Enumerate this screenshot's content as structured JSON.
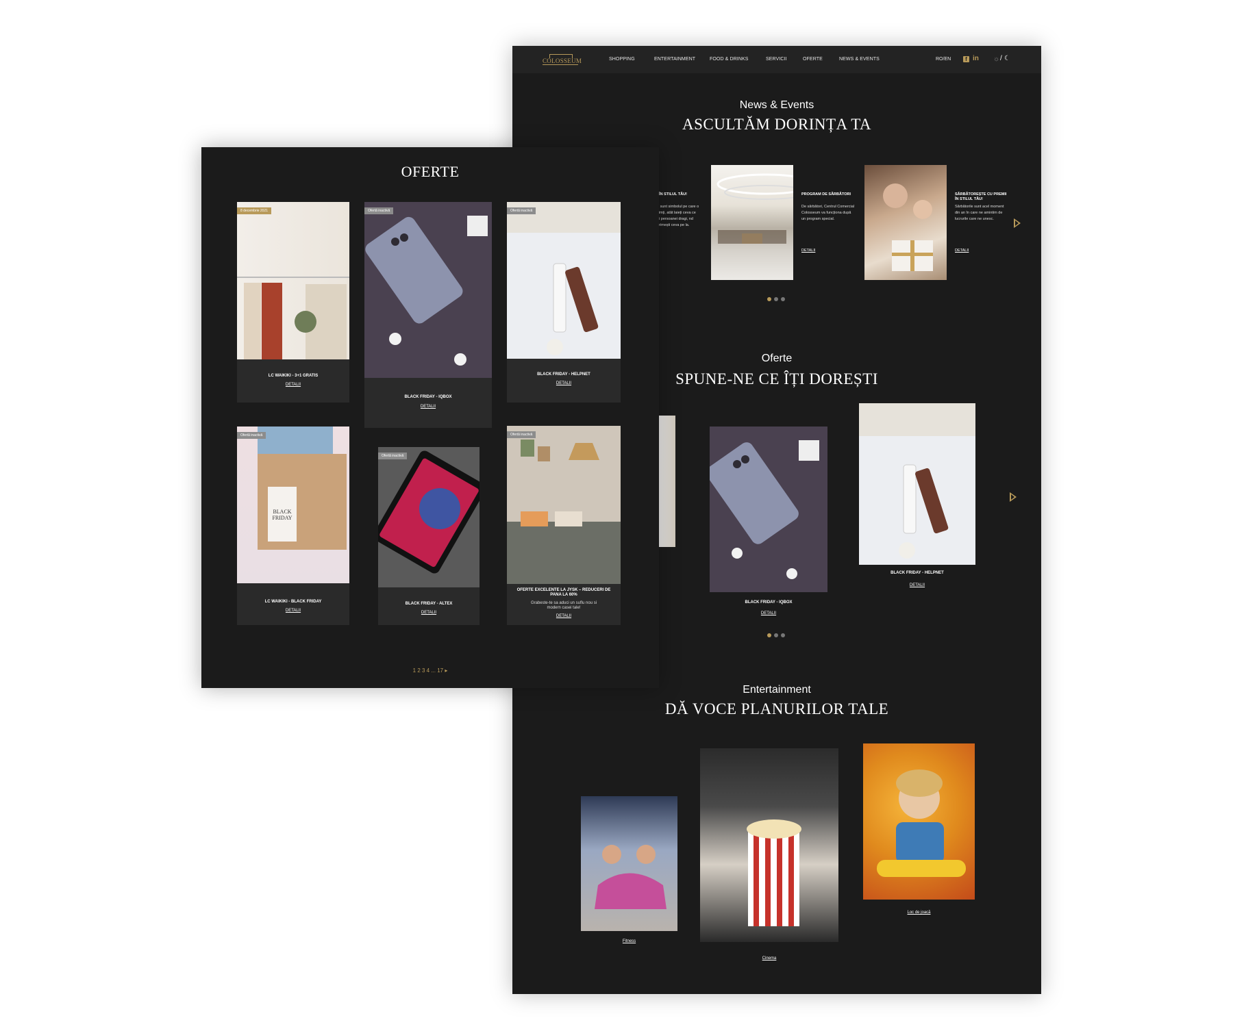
{
  "header": {
    "logo": "COLOSSEUM",
    "nav": [
      "SHOPPING",
      "ENTERTAINMENT",
      "FOOD & DRINKS",
      "SERVICII",
      "OFERTE",
      "NEWS & EVENTS"
    ],
    "lang": "RO/EN",
    "fb_icon": "facebook-icon",
    "in_icon": "linkedin-icon",
    "theme_toggle": "sun-moon-icon"
  },
  "news": {
    "kicker": "News & Events",
    "title": "ASCULTĂM DORINȚA TA",
    "partial_item": {
      "title": "I ÎN STILUL TĂU!",
      "text": "e sunt simbolul pe care o simți, atât laieți ceva ce îți persoanei dragi, nd primești ceva pe la."
    },
    "items": [
      {
        "title": "PROGRAM DE SĂRBĂTORI",
        "text": "De sărbători, Centrul Comercial Colosseum va funcționa după un program special.",
        "link": "DETALII"
      },
      {
        "title": "SĂRBĂTOREȘTE CU PREMII ÎN STILUL TĂU!",
        "text": "Sărbătorile sunt acel moment din an în care ne amintim de lucrurile care ne unesc.",
        "link": "DETALII"
      }
    ]
  },
  "oferte_section": {
    "kicker": "Oferte",
    "title": "SPUNE-NE CE ÎȚI DOREȘTI",
    "items": [
      {
        "title": "BLACK FRIDAY - IQBOX",
        "link": "DETALII"
      },
      {
        "title": "BLACK FRIDAY - HELPNET",
        "link": "DETALII"
      }
    ]
  },
  "entertainment": {
    "kicker": "Entertainment",
    "title": "DĂ VOCE PLANURILOR TALE",
    "items": [
      {
        "label": "Fitness"
      },
      {
        "label": "Cinema"
      },
      {
        "label": "Loc de joacă"
      }
    ]
  },
  "offers_page": {
    "title": "OFERTE",
    "cards": [
      {
        "badge": "8 decembrie 2021",
        "title": "LC WAIKIKI - 3+1 GRATIS",
        "link": "DETALII"
      },
      {
        "badge": "Ofertă inactivă",
        "title": "BLACK FRIDAY - IQBOX",
        "link": "DETALII"
      },
      {
        "badge": "Ofertă inactivă",
        "title": "BLACK FRIDAY - HELPNET",
        "link": "DETALII"
      },
      {
        "badge": "Ofertă inactivă",
        "title": "LC WAIKIKI - BLACK FRIDAY",
        "link": "DETALII"
      },
      {
        "badge": "Ofertă inactivă",
        "title": "BLACK FRIDAY - ALTEX",
        "link": "DETALII"
      },
      {
        "badge": "Ofertă inactivă",
        "title": "OFERTE EXCELENTE LA JYSK – REDUCERI DE PANA LA 60%",
        "desc": "Grabeste-te sa aduci un suflu nou si modern casei tale!",
        "link": "DETALII"
      }
    ],
    "pagination": "1 2 3 4 ... 17 ▸",
    "black_friday_tag": "BLACK FRIDAY"
  },
  "colors": {
    "accent": "#b89a5a",
    "background": "#1b1b1b",
    "card": "#2a2a2a"
  }
}
